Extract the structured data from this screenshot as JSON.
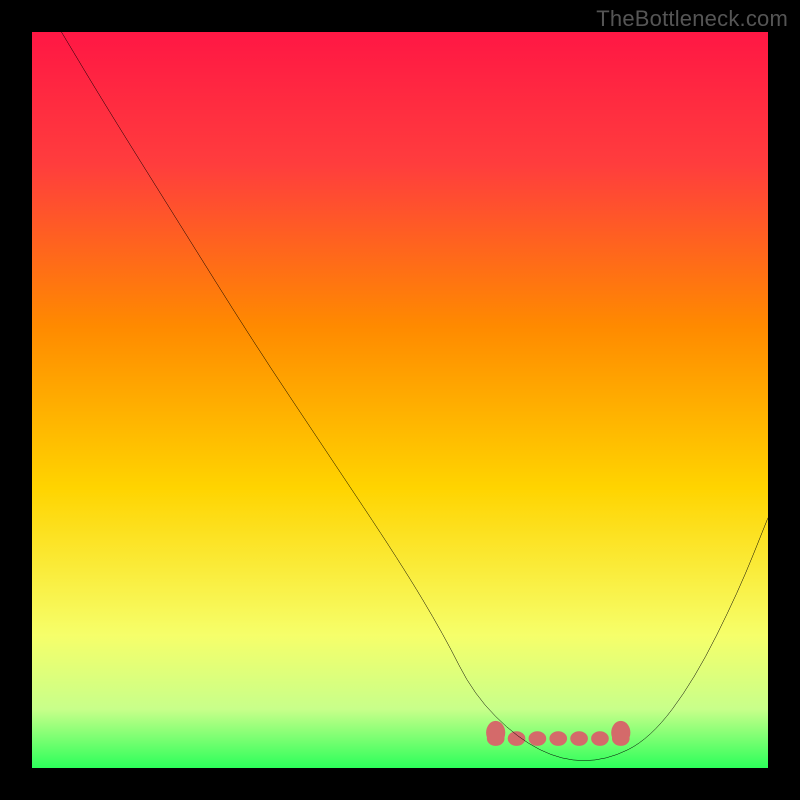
{
  "watermark": "TheBottleneck.com",
  "chart_data": {
    "type": "line",
    "title": "",
    "xlabel": "",
    "ylabel": "",
    "xlim": [
      0,
      100
    ],
    "ylim": [
      0,
      100
    ],
    "series": [
      {
        "name": "curve",
        "x": [
          4,
          10,
          20,
          30,
          40,
          50,
          56,
          60,
          66,
          72,
          78,
          84,
          90,
          96,
          100
        ],
        "values": [
          100,
          90,
          74,
          58,
          43,
          28,
          18,
          10,
          4,
          1,
          1,
          4,
          12,
          24,
          34
        ]
      }
    ],
    "highlight_band": {
      "from_x": 63,
      "to_x": 80,
      "y": 4,
      "color": "#d46a6a"
    },
    "gradient_stops": [
      {
        "offset": 0.0,
        "color": "#ff1744"
      },
      {
        "offset": 0.18,
        "color": "#ff3d3d"
      },
      {
        "offset": 0.4,
        "color": "#ff8a00"
      },
      {
        "offset": 0.62,
        "color": "#ffd400"
      },
      {
        "offset": 0.82,
        "color": "#f6ff6a"
      },
      {
        "offset": 0.92,
        "color": "#c8ff8a"
      },
      {
        "offset": 1.0,
        "color": "#2cff5a"
      }
    ]
  }
}
